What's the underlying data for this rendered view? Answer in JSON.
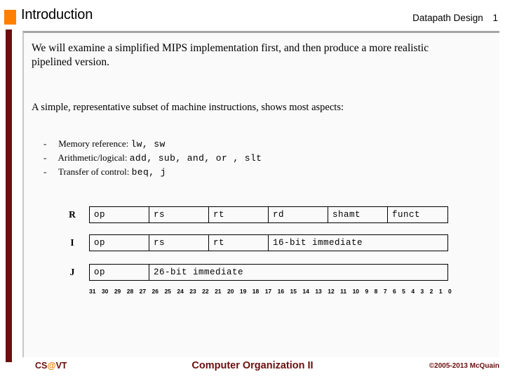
{
  "header": {
    "title": "Introduction",
    "course_topic": "Datapath Design",
    "slide_number": "1",
    "accent_color": "#FF7F00"
  },
  "theme": {
    "left_bar_color": "#6B0E0E",
    "panel_background": "#FAFAFA",
    "panel_border_color": "#A6A6A6"
  },
  "body": {
    "paragraph_1": "We will examine a simplified MIPS implementation first, and then produce a more realistic pipelined version.",
    "paragraph_2": "A simple, representative subset of machine instructions, shows most aspects:",
    "bullets": [
      {
        "dash": "-",
        "label": "Memory reference:",
        "ops": "lw, sw"
      },
      {
        "dash": "-",
        "label": "Arithmetic/logical:",
        "ops": "add, sub, and, or ,  slt"
      },
      {
        "dash": "-",
        "label": "Transfer of control:",
        "ops": "beq, j"
      }
    ]
  },
  "instruction_formats": {
    "rows": [
      {
        "tag": "R",
        "fields": [
          {
            "label": "op",
            "width_class": "w-small"
          },
          {
            "label": "rs",
            "width_class": "w-small"
          },
          {
            "label": "rt",
            "width_class": "w-small"
          },
          {
            "label": "rd",
            "width_class": "w-small"
          },
          {
            "label": "shamt",
            "width_class": "w-shamt"
          },
          {
            "label": "funct",
            "width_class": "w-funct"
          }
        ]
      },
      {
        "tag": "I",
        "fields": [
          {
            "label": "op",
            "width_class": "w-small"
          },
          {
            "label": "rs",
            "width_class": "w-small"
          },
          {
            "label": "rt",
            "width_class": "w-small"
          },
          {
            "label": "16-bit immediate",
            "width_class": "w-imm16"
          }
        ]
      },
      {
        "tag": "J",
        "fields": [
          {
            "label": "op",
            "width_class": "w-small"
          },
          {
            "label": "26-bit immediate",
            "width_class": "w-imm26"
          }
        ]
      }
    ],
    "bit_numbers": [
      "31",
      "30",
      "29",
      "28",
      "27",
      "26",
      "25",
      "24",
      "23",
      "22",
      "21",
      "20",
      "19",
      "18",
      "17",
      "16",
      "15",
      "14",
      "13",
      "12",
      "11",
      "10",
      "9",
      "8",
      "7",
      "6",
      "5",
      "4",
      "3",
      "2",
      "1",
      "0"
    ]
  },
  "footer": {
    "cs_prefix": "CS",
    "cs_at": "@",
    "cs_suffix": "VT",
    "center": "Computer Organization II",
    "copyright": "©2005-2013 McQuain",
    "color": "#6B0E0E",
    "at_color": "#E8820C"
  }
}
